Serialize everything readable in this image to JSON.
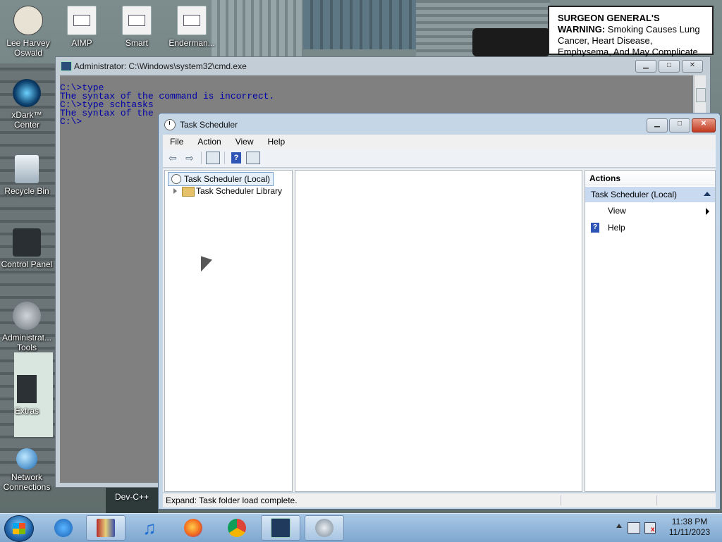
{
  "desktop": {
    "icons": [
      {
        "label": "Lee Harvey\nOswald",
        "icon": "character-icon"
      },
      {
        "label": "AIMP",
        "icon": "file-icon"
      },
      {
        "label": "Smart",
        "icon": "file-icon"
      },
      {
        "label": "Enderman...",
        "icon": "file-icon"
      },
      {
        "label": "xDark™\nCenter",
        "icon": "orb-icon"
      },
      {
        "label": "Recycle Bin",
        "icon": "recycle-bin-icon"
      },
      {
        "label": "Control Panel",
        "icon": "control-panel-icon"
      },
      {
        "label": "Administrat...\nTools",
        "icon": "gear-icon"
      },
      {
        "label": "Extras",
        "icon": "folder-icon"
      },
      {
        "label": "Network\nConnections",
        "icon": "globe-icon"
      }
    ],
    "warning": {
      "bold": "SURGEON GENERAL'S WARNING:",
      "rest": " Smoking Causes Lung Cancer, Heart Disease, Emphysema, And May Complicate Pregnancy."
    },
    "peek_label": "Dev-C++"
  },
  "cmd": {
    "title": "Administrator: C:\\Windows\\system32\\cmd.exe",
    "lines": [
      "C:\\>type",
      "The syntax of the command is incorrect.",
      "",
      "C:\\>type schtasks",
      "The syntax of the",
      "",
      "C:\\>"
    ]
  },
  "task_scheduler": {
    "title": "Task Scheduler",
    "menu": [
      "File",
      "Action",
      "View",
      "Help"
    ],
    "tree": {
      "root": "Task Scheduler (Local)",
      "child": "Task Scheduler Library"
    },
    "actions": {
      "header": "Actions",
      "section": "Task Scheduler (Local)",
      "items": [
        {
          "label": "View",
          "has_submenu": true
        },
        {
          "label": "Help",
          "icon": "help-icon"
        }
      ]
    },
    "status": "Expand:  Task folder load complete."
  },
  "taskbar": {
    "apps": [
      {
        "name": "internet-explorer-icon",
        "active": false
      },
      {
        "name": "winrar-icon",
        "active": true
      },
      {
        "name": "itunes-icon",
        "active": false
      },
      {
        "name": "firefox-icon",
        "active": false
      },
      {
        "name": "chrome-icon",
        "active": false
      },
      {
        "name": "cmd-icon",
        "active": true
      },
      {
        "name": "task-scheduler-icon",
        "active": true
      }
    ],
    "clock": {
      "time": "11:38 PM",
      "date": "11/11/2023"
    }
  }
}
